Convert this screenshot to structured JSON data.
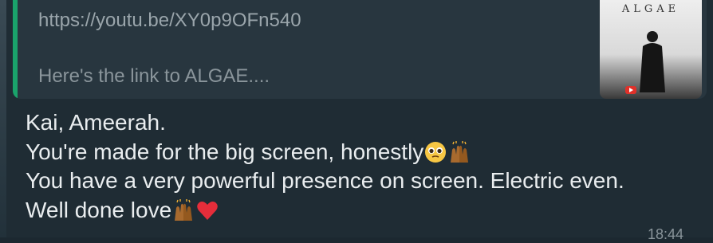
{
  "quoted_message": {
    "link": "https://youtu.be/XY0p9OFn540",
    "caption": "Here's the link to ALGAE....",
    "thumbnail": {
      "title": "ALGAE",
      "badge_icon": "youtube-icon"
    },
    "accent_color": "#1aa36b"
  },
  "message": {
    "lines": [
      "Kai, Ameerah.",
      "You're made for the big screen, honestly",
      "You have a very powerful presence on screen. Electric even.",
      "Well done love"
    ],
    "emojis": [
      "pleading-face-icon",
      "raised-hands-icon",
      "raised-hands-icon",
      "red-heart-icon"
    ],
    "timestamp": "18:44"
  },
  "colors": {
    "background": "#1f2c34",
    "quote_background": "#28363f",
    "text": "#e9edef",
    "secondary_text": "#8a959b"
  }
}
